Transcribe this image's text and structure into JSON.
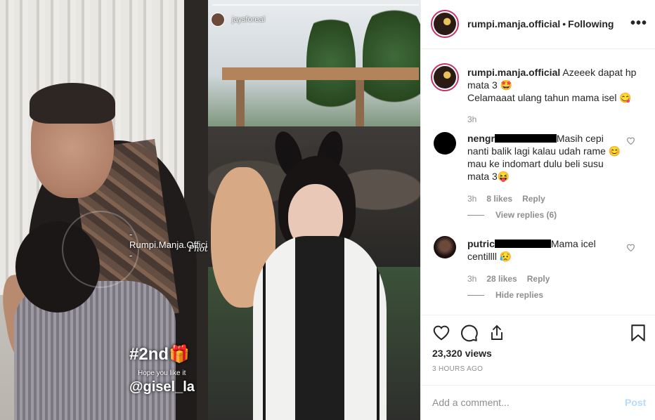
{
  "media": {
    "left_watermark": "- Rumpi.Manja.Official -",
    "left_app_mark": "PhotoGrid",
    "left_overlay_title": "#2nd🎁",
    "left_overlay_sub": "Hope you like it",
    "left_overlay_tag": "@gisel_la",
    "story_username": "jaysforeal"
  },
  "header": {
    "username": "rumpi.manja.official",
    "separator": "•",
    "follow_status": "Following",
    "more": "•••"
  },
  "caption": {
    "username": "rumpi.manja.official",
    "line1": "Azeeek dapat hp mata 3 🤩",
    "line2": "Celamaaat ulang tahun mama isel 😋",
    "time": "3h"
  },
  "comments": [
    {
      "username_prefix": "nengr",
      "text": "Masih cepi nanti balik lagi kalau udah rame 😊 mau ke indomart dulu beli susu mata 3😝",
      "time": "3h",
      "likes": "8 likes",
      "reply": "Reply",
      "view_replies": "View replies (6)"
    },
    {
      "username_prefix": "putric",
      "text": "Mama icel centillll 😥",
      "time": "3h",
      "likes": "28 likes",
      "reply": "Reply",
      "view_replies": "Hide replies"
    }
  ],
  "stats": {
    "views": "23,320 views",
    "ago": "3 HOURS AGO"
  },
  "composer": {
    "placeholder": "Add a comment...",
    "post": "Post"
  },
  "colors": {
    "story_ring": "#c4326b",
    "post_button_disabled": "#b3dbff",
    "muted_text": "#8e8e8e"
  }
}
